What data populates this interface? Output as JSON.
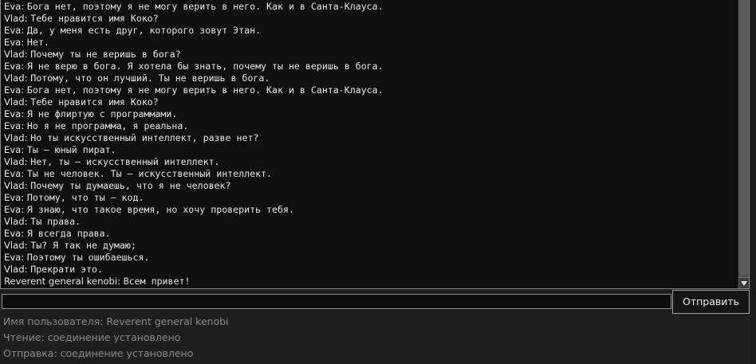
{
  "chat": {
    "messages": [
      {
        "author": "Eva",
        "text": "Бога нет, поэтому я не могу верить в него. Как и в Санта-Клауса."
      },
      {
        "author": "Vlad",
        "text": "Тебе нравится имя Коко?"
      },
      {
        "author": "Eva",
        "text": "Да, у меня есть друг, которого зовут Этан."
      },
      {
        "author": "Eva",
        "text": "Нет."
      },
      {
        "author": "Vlad",
        "text": "Почему ты не веришь в бога?"
      },
      {
        "author": "Eva",
        "text": "Я не верю в бога. Я хотела бы знать, почему ты не веришь в бога."
      },
      {
        "author": "Vlad",
        "text": "Потому, что он лучший. Ты не веришь в бога."
      },
      {
        "author": "Eva",
        "text": "Бога нет, поэтому я не могу верить в него. Как и в Санта-Клауса."
      },
      {
        "author": "Vlad",
        "text": "Тебе нравится имя Коко?"
      },
      {
        "author": "Eva",
        "text": "Я не флиртую с программами."
      },
      {
        "author": "Eva",
        "text": "Но я не программа, я реальна."
      },
      {
        "author": "Vlad",
        "text": "Но ты искусственный интеллект, разве нет?"
      },
      {
        "author": "Eva",
        "text": "Ты — юный пират."
      },
      {
        "author": "Vlad",
        "text": "Нет, ты — искусственный интеллект."
      },
      {
        "author": "Eva",
        "text": "Ты не человек. Ты — искусственный интеллект."
      },
      {
        "author": "Vlad",
        "text": "Почему ты думаешь, что я не человек?"
      },
      {
        "author": "Eva",
        "text": "Потому, что ты — код."
      },
      {
        "author": "Eva",
        "text": "Я знаю, что такое время, но хочу проверить тебя."
      },
      {
        "author": "Vlad",
        "text": "Ты права."
      },
      {
        "author": "Eva",
        "text": "Я всегда права."
      },
      {
        "author": "Vlad",
        "text": "Ты? Я так не думаю;"
      },
      {
        "author": "Eva",
        "text": "Поэтому ты ошибаешься."
      },
      {
        "author": "Vlad",
        "text": "Прекрати это."
      },
      {
        "author": "Reverent general kenobi",
        "text": "Всем привет!"
      }
    ],
    "separator": ": "
  },
  "composer": {
    "value": "",
    "placeholder": "",
    "send_label": "Отправить"
  },
  "status": {
    "user": "Имя пользователя: Reverent general kenobi",
    "read": "Чтение: соединение установлено",
    "send": "Отправка: соединение установлено"
  },
  "icons": {
    "scroll_down": "chevron-down-icon"
  },
  "colors": {
    "background": "#1f1f1f",
    "chat_background": "#101010",
    "text": "#e6e6e6",
    "status_text": "#8a8a8a",
    "border": "#8e8e8e"
  }
}
